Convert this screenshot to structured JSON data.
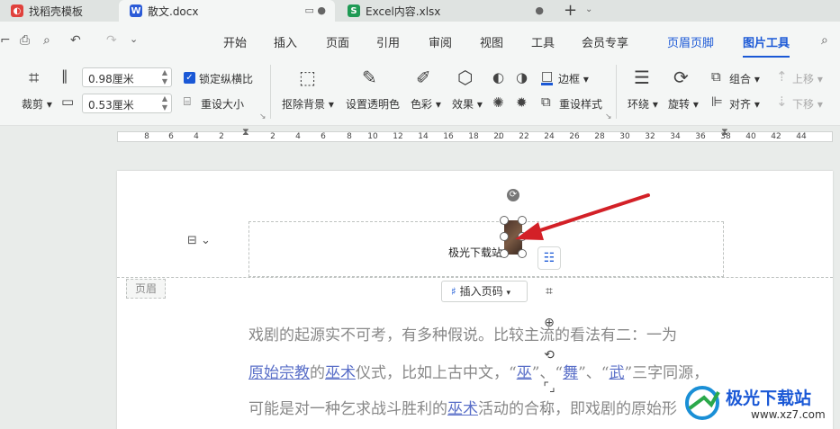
{
  "tabs": [
    {
      "label": "找稻壳模板",
      "icon_color": "#e0413c",
      "icon_char": "◐"
    },
    {
      "label": "散文.docx",
      "icon_color": "#2b5bd7",
      "icon_char": "W"
    },
    {
      "label": "Excel内容.xlsx",
      "icon_color": "#1e9a54",
      "icon_char": "S"
    }
  ],
  "tab_add": "+",
  "menu": [
    "开始",
    "插入",
    "页面",
    "引用",
    "审阅",
    "视图",
    "工具",
    "会员专享",
    "页眉页脚",
    "图片工具"
  ],
  "ribbon": {
    "crop_label": "裁剪",
    "width_value": "0.98厘米",
    "height_value": "0.53厘米",
    "lock_ratio_label": "锁定纵横比",
    "reset_size_label": "重设大小",
    "remove_bg_label": "抠除背景",
    "set_transparent_label": "设置透明色",
    "color_label": "色彩",
    "effect_label": "效果",
    "border_label": "边框",
    "reset_style_label": "重设样式",
    "wrap_label": "环绕",
    "rotate_label": "旋转",
    "group_label": "组合",
    "align_label": "对齐",
    "move_up_label": "上移",
    "move_down_label": "下移"
  },
  "ruler_numbers": [
    "8",
    "6",
    "4",
    "2",
    "2",
    "4",
    "6",
    "8",
    "10",
    "12",
    "14",
    "16",
    "18",
    "20",
    "22",
    "24",
    "26",
    "28",
    "30",
    "32",
    "34",
    "36",
    "38",
    "40",
    "42",
    "44"
  ],
  "document": {
    "header_text": "极光下载站",
    "header_tag": "页眉",
    "insert_page_num": "插入页码",
    "para1": "戏剧的起源实不可考，有多种假说。比较主流的看法有二：一为",
    "para2_parts": [
      "原始宗教",
      "的",
      "巫术",
      "仪式，比如上古中文，“",
      "巫",
      "”、“",
      "舞",
      "”、“",
      "武",
      "”三字同源，"
    ],
    "para3_parts": [
      "可能是对一种乞求战斗胜利的",
      "巫术",
      "活动的合称，即戏剧的原始形"
    ]
  },
  "watermark": {
    "title": "极光下载站",
    "url": "www.xz7.com"
  },
  "colors": {
    "accent": "#1a58d6",
    "arrow": "#d32027"
  }
}
